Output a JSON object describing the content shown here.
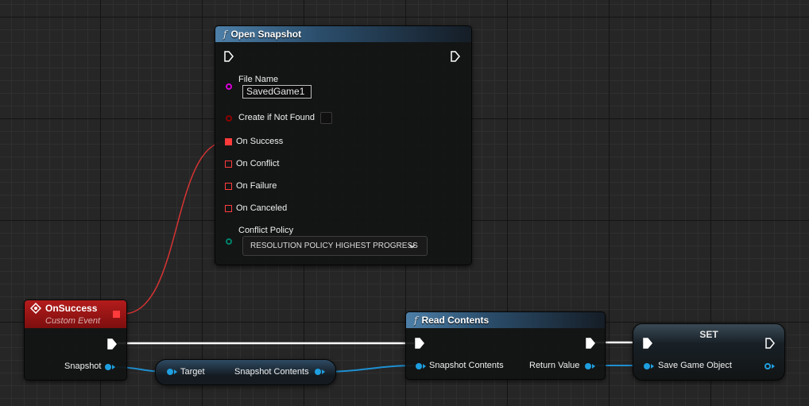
{
  "open_snapshot": {
    "title": "Open Snapshot",
    "file_name_label": "File Name",
    "file_name_value": "SavedGame1",
    "create_if_not_found_label": "Create if Not Found",
    "on_success_label": "On Success",
    "on_conflict_label": "On Conflict",
    "on_failure_label": "On Failure",
    "on_canceled_label": "On Canceled",
    "conflict_policy_label": "Conflict Policy",
    "conflict_policy_value": "RESOLUTION POLICY HIGHEST PROGRESS"
  },
  "on_success_event": {
    "title": "OnSuccess",
    "subtitle": "Custom Event",
    "snapshot_label": "Snapshot"
  },
  "get_snapshot_contents": {
    "target_label": "Target",
    "output_label": "Snapshot Contents"
  },
  "read_contents": {
    "title": "Read Contents",
    "input_label": "Snapshot Contents",
    "return_label": "Return Value"
  },
  "set_node": {
    "title": "SET",
    "input_label": "Save Game Object"
  },
  "icons": {
    "function": "function-icon",
    "event": "event-diamond-icon",
    "exec": "exec-pin-icon",
    "dropdown": "chevron-down-icon"
  },
  "colors": {
    "object_pin": "#1e9fe0",
    "string_pin": "#d500d5",
    "bool_pin": "#8c0000",
    "delegate_pin": "#ff3b3b",
    "enum_pin": "#00836b",
    "event_header": "#a11414",
    "function_header": "#4d7fa8"
  }
}
